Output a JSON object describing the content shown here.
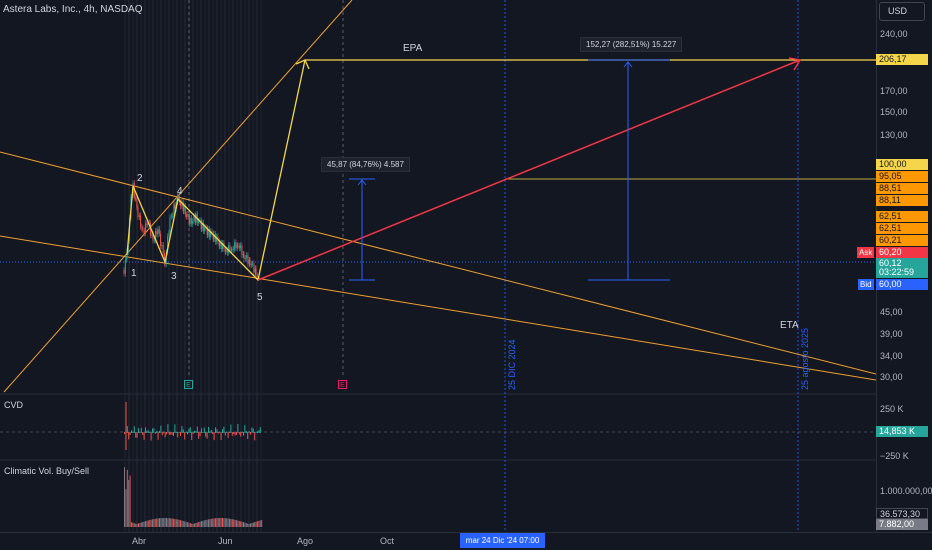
{
  "header": {
    "symbol_title": "Astera Labs, Inc., 4h, NASDAQ",
    "currency": "USD"
  },
  "price_axis": {
    "ticks": [
      "240,00",
      "170,00",
      "150,00",
      "130,00",
      "45,00",
      "39,00",
      "34,00",
      "30,00"
    ],
    "tags": [
      {
        "label": "206,17",
        "color": "#f5d64b"
      },
      {
        "label": "100,00",
        "color": "#f5d64b"
      },
      {
        "label": "95,05",
        "color": "#ff9800"
      },
      {
        "label": "88,51",
        "color": "#ff9800"
      },
      {
        "label": "88,11",
        "color": "#ff9800"
      },
      {
        "label": "62,51",
        "color": "#ff9800"
      },
      {
        "label": "62,51",
        "color": "#ff9800"
      },
      {
        "label": "60,21",
        "color": "#ff9800"
      },
      {
        "label": "60,20",
        "color": "#f23645"
      },
      {
        "label": "60,12",
        "color": "#26a69a"
      },
      {
        "label": "03:22:59",
        "color": "#26a69a"
      },
      {
        "label": "60,00",
        "color": "#2962ff"
      }
    ],
    "ask_label": "Ask",
    "bid_label": "Bid"
  },
  "annotations": {
    "epa": "EPA",
    "eta": "ETA",
    "measure_small": "45,87 (84,76%) 4.587",
    "measure_large": "152,27 (282,51%) 15.227",
    "waves": [
      "1",
      "2",
      "3",
      "4",
      "5"
    ],
    "vertical_dec": "25 DIC 2024",
    "vertical_aug": "25 agosto 2025",
    "earnings_marker": "E"
  },
  "cvd_pane": {
    "label": "CVD",
    "ticks": [
      "250 K",
      "−250 K"
    ],
    "value": "14,853 K"
  },
  "vol_pane": {
    "label": "Climatic Vol. Buy/Sell",
    "ticks": [
      "1.000.000,00"
    ],
    "value1": "36.573,30",
    "value2": "7.882,00"
  },
  "time_axis": {
    "labels": [
      "Abr",
      "Jun",
      "Ago",
      "Oct"
    ],
    "cursor_date": "mar 24 Dic '24   07:00"
  },
  "colors": {
    "background": "#131722",
    "accent_blue": "#2962ff",
    "line_orange": "#f0a030",
    "line_yellow": "#f5d64b",
    "arrow_red": "#f23645",
    "up": "#26a69a",
    "down": "#ef5350"
  }
}
